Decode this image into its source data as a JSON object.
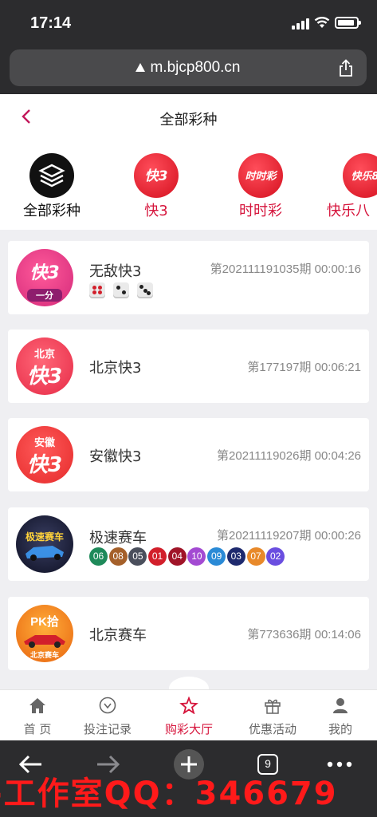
{
  "status": {
    "time": "17:14"
  },
  "browser": {
    "url": "m.bjcp800.cn",
    "tab_count": "9"
  },
  "header": {
    "title": "全部彩种"
  },
  "categories": [
    {
      "label": "全部彩种",
      "icon": "layers-icon",
      "color": "#111111"
    },
    {
      "label": "快3",
      "icon": "kuai3-logo-icon",
      "color": "#d6153c",
      "logo_text": "快3"
    },
    {
      "label": "时时彩",
      "icon": "shishicai-logo-icon",
      "color": "#d6153c",
      "logo_text": "时时彩"
    },
    {
      "label": "快乐八",
      "icon": "kuaile8-logo-icon",
      "color": "#d6153c",
      "logo_text": "快乐8"
    }
  ],
  "lotteries": [
    {
      "name": "无敌快3",
      "period": "第20211119​1035期 00:00:16",
      "logo_text": "快3",
      "logo_sub": "一分",
      "dice": [
        4,
        2,
        3
      ]
    },
    {
      "name": "北京快3",
      "period": "第177197期 00:06:21",
      "logo_text": "快3",
      "logo_sub": "北京"
    },
    {
      "name": "安徽快3",
      "period": "第20211119026期 00:04:26",
      "logo_text": "快3",
      "logo_sub": "安徽"
    },
    {
      "name": "极速赛车",
      "period": "第20211119207期 00:00:26",
      "logo_text": "极速赛车",
      "balls": [
        {
          "n": "06",
          "c": "#1f8a5a"
        },
        {
          "n": "08",
          "c": "#a5602a"
        },
        {
          "n": "05",
          "c": "#4a4f5c"
        },
        {
          "n": "01",
          "c": "#d21f2b"
        },
        {
          "n": "04",
          "c": "#a01428"
        },
        {
          "n": "10",
          "c": "#a34ad2"
        },
        {
          "n": "09",
          "c": "#2a8ad6"
        },
        {
          "n": "03",
          "c": "#1e2a6e"
        },
        {
          "n": "07",
          "c": "#e8892a"
        },
        {
          "n": "02",
          "c": "#6a4ee0"
        }
      ]
    },
    {
      "name": "北京赛车",
      "period": "第773636期 00:14:06",
      "logo_text": "PK拾",
      "logo_sub": "北京赛车"
    }
  ],
  "tabs": [
    {
      "label": "首 页",
      "icon": "home-icon"
    },
    {
      "label": "投注记录",
      "icon": "record-icon"
    },
    {
      "label": "购彩大厅",
      "icon": "star-icon",
      "active": true
    },
    {
      "label": "优惠活动",
      "icon": "gift-icon"
    },
    {
      "label": "我的",
      "icon": "user-icon"
    }
  ],
  "watermark": "-工作室QQ：346679"
}
